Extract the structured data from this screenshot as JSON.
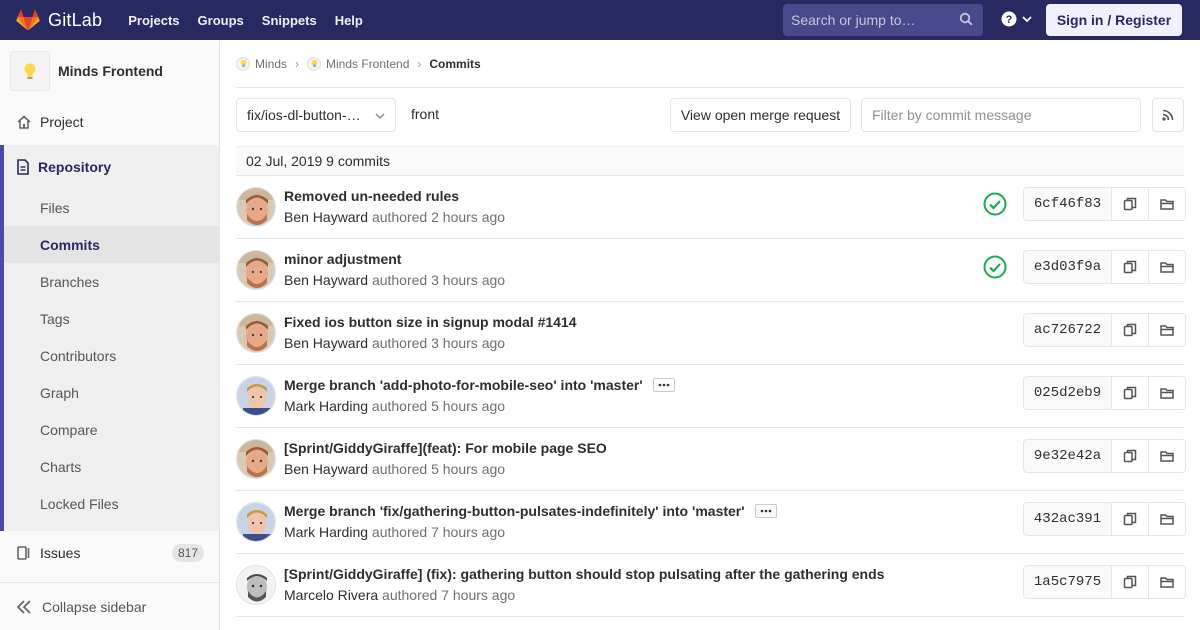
{
  "navbar": {
    "brand": "GitLab",
    "links": [
      "Projects",
      "Groups",
      "Snippets",
      "Help"
    ],
    "search_placeholder": "Search or jump to…",
    "signin": "Sign in / Register",
    "bg": "#292961"
  },
  "sidebar": {
    "project_name": "Minds Frontend",
    "project_label": "Project",
    "repository_label": "Repository",
    "repo_items": [
      "Files",
      "Commits",
      "Branches",
      "Tags",
      "Contributors",
      "Graph",
      "Compare",
      "Charts",
      "Locked Files"
    ],
    "active_item": "Commits",
    "issues_label": "Issues",
    "issues_count": "817",
    "collapse_label": "Collapse sidebar"
  },
  "breadcrumbs": {
    "group": "Minds",
    "project": "Minds Frontend",
    "current": "Commits"
  },
  "toolbar": {
    "branch": "fix/ios-dl-button-…",
    "path": "front",
    "merge_request_button": "View open merge request",
    "filter_placeholder": "Filter by commit message"
  },
  "day_header": "02 Jul, 2019 9 commits",
  "commits": [
    {
      "title": "Removed un-needed rules",
      "author": "Ben Hayward",
      "authored": "authored",
      "time": "2 hours ago",
      "sha": "6cf46f83",
      "status": "passed",
      "avatar": "ben",
      "ellipsis": false
    },
    {
      "title": "minor adjustment",
      "author": "Ben Hayward",
      "authored": "authored",
      "time": "3 hours ago",
      "sha": "e3d03f9a",
      "status": "passed",
      "avatar": "ben",
      "ellipsis": false
    },
    {
      "title": "Fixed ios button size in signup modal #1414",
      "author": "Ben Hayward",
      "authored": "authored",
      "time": "3 hours ago",
      "sha": "ac726722",
      "status": "",
      "avatar": "ben",
      "ellipsis": false
    },
    {
      "title": "Merge branch 'add-photo-for-mobile-seo' into 'master'",
      "author": "Mark Harding",
      "authored": "authored",
      "time": "5 hours ago",
      "sha": "025d2eb9",
      "status": "",
      "avatar": "mark",
      "ellipsis": true
    },
    {
      "title": "[Sprint/GiddyGiraffe](feat): For mobile page SEO",
      "author": "Ben Hayward",
      "authored": "authored",
      "time": "5 hours ago",
      "sha": "9e32e42a",
      "status": "",
      "avatar": "ben",
      "ellipsis": false
    },
    {
      "title": "Merge branch 'fix/gathering-button-pulsates-indefinitely' into 'master'",
      "author": "Mark Harding",
      "authored": "authored",
      "time": "7 hours ago",
      "sha": "432ac391",
      "status": "",
      "avatar": "mark",
      "ellipsis": true
    },
    {
      "title": "[Sprint/GiddyGiraffe] (fix): gathering button should stop pulsating after the gathering ends",
      "author": "Marcelo Rivera",
      "authored": "authored",
      "time": "7 hours ago",
      "sha": "1a5c7975",
      "status": "",
      "avatar": "marcelo",
      "ellipsis": false
    }
  ],
  "colors": {
    "success": "#1aaa55",
    "active_border": "#4b4ba3"
  }
}
